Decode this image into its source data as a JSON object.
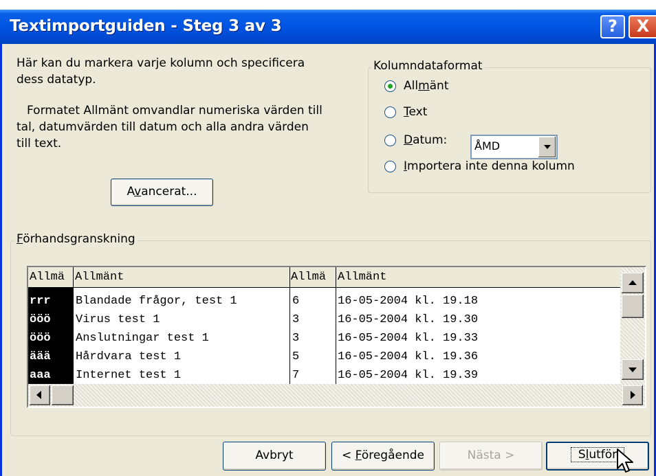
{
  "window": {
    "title": "Textimportguiden - Steg 3 av 3",
    "help_button": "?",
    "close_button": "X"
  },
  "intro_text_line1": "Här kan du markera varje kolumn och specificera",
  "intro_text_line2": "dess datatyp.",
  "info_text_line1": "Formatet Allmänt omvandlar numeriska värden till",
  "info_text_line2": "tal, datumvärden till datum och alla andra värden",
  "info_text_line3": "till text.",
  "advanced_button": {
    "pre": "A",
    "u": "v",
    "post": "ancerat..."
  },
  "column_format": {
    "label": "Kolumndataformat",
    "options": [
      {
        "pre": "All",
        "u": "m",
        "post": "änt",
        "checked": true
      },
      {
        "pre": "",
        "u": "T",
        "post": "ext",
        "checked": false
      },
      {
        "pre": "",
        "u": "D",
        "post": "atum:",
        "checked": false
      },
      {
        "pre": "",
        "u": "I",
        "post": "mportera inte denna kolumn",
        "checked": false
      }
    ],
    "date_format_value": "ÅMD"
  },
  "preview": {
    "label_pre": "",
    "label_u": "F",
    "label_post": "örhandsgranskning",
    "headers": [
      "Allmä",
      "Allmänt",
      "Allmä",
      "Allmänt"
    ],
    "rows": [
      [
        "rrr",
        "Blandade frågor, test 1",
        "6",
        "16-05-2004 kl. 19.18"
      ],
      [
        "ööö",
        "Virus test 1",
        "3",
        "16-05-2004 kl. 19.30"
      ],
      [
        "ööö",
        "Anslutningar test 1",
        "3",
        "16-05-2004 kl. 19.33"
      ],
      [
        "äää",
        "Hårdvara test 1",
        "5",
        "16-05-2004 kl. 19.36"
      ],
      [
        "aaa",
        "Internet test 1",
        "7",
        "16-05-2004 kl. 19.39"
      ]
    ]
  },
  "buttons": {
    "cancel": "Avbryt",
    "back_pre": "< ",
    "back_u": "F",
    "back_post": "öregående",
    "next": "Nästa >",
    "finish_pre": "S",
    "finish_u": "l",
    "finish_post": "utför"
  },
  "colors": {
    "title_bar": "#0054e3",
    "dialog_bg": "#ece9d8",
    "selected_column": "#000000"
  }
}
